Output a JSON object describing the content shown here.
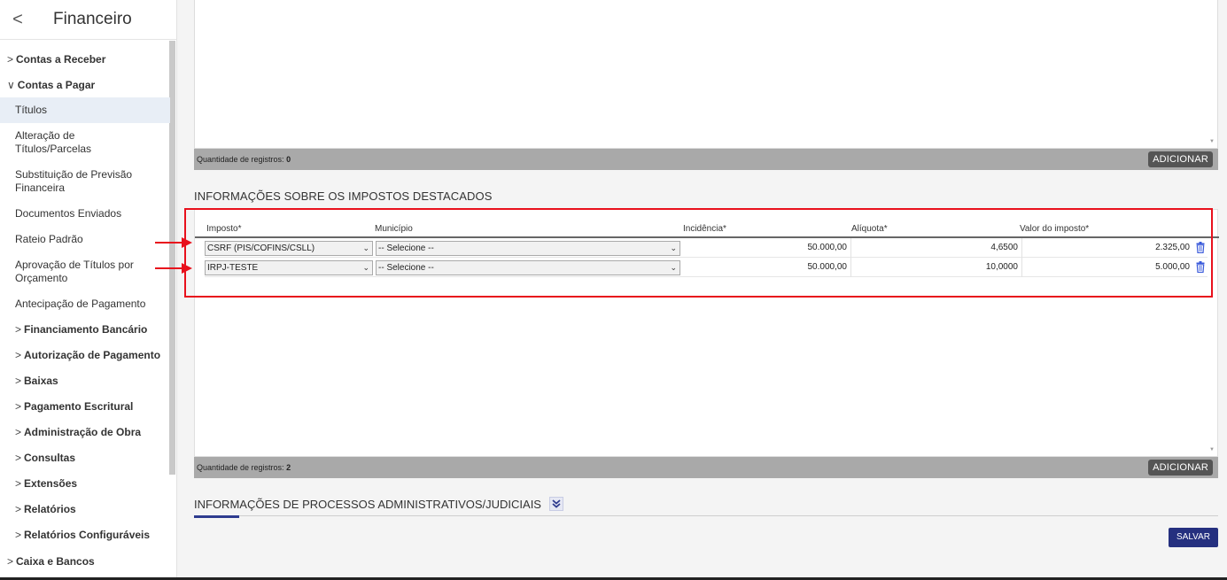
{
  "sidebar": {
    "back_icon": "chevron-left-icon",
    "title": "Financeiro",
    "items": [
      {
        "label": "Contas a Receber",
        "level": 1,
        "chevron": ">"
      },
      {
        "label": "Contas a Pagar",
        "level": 1,
        "chevron": "∨"
      },
      {
        "label": "Títulos",
        "level": 2,
        "active": true
      },
      {
        "label": "Alteração de Títulos/Parcelas",
        "level": 2
      },
      {
        "label": "Substituição de Previsão Financeira",
        "level": 2
      },
      {
        "label": "Documentos Enviados",
        "level": 2
      },
      {
        "label": "Rateio Padrão",
        "level": 2
      },
      {
        "label": "Aprovação de Títulos por Orçamento",
        "level": 2
      },
      {
        "label": "Antecipação de Pagamento",
        "level": 2
      },
      {
        "label": "Financiamento Bancário",
        "level": 2,
        "chevron": ">"
      },
      {
        "label": "Autorização de Pagamento",
        "level": 2,
        "chevron": ">"
      },
      {
        "label": "Baixas",
        "level": 2,
        "chevron": ">"
      },
      {
        "label": "Pagamento Escritural",
        "level": 2,
        "chevron": ">"
      },
      {
        "label": "Administração de Obra",
        "level": 2,
        "chevron": ">"
      },
      {
        "label": "Consultas",
        "level": 2,
        "chevron": ">"
      },
      {
        "label": "Extensões",
        "level": 2,
        "chevron": ">"
      },
      {
        "label": "Relatórios",
        "level": 2,
        "chevron": ">"
      },
      {
        "label": "Relatórios Configuráveis",
        "level": 2,
        "chevron": ">"
      },
      {
        "label": "Caixa e Bancos",
        "level": 1,
        "chevron": ">"
      }
    ]
  },
  "top_panel": {
    "records_label": "Quantidade de registros:",
    "records_count": "0",
    "add_label": "ADICIONAR"
  },
  "taxes": {
    "section_title": "INFORMAÇÕES SOBRE OS IMPOSTOS DESTACADOS",
    "headers": {
      "imposto": "Imposto*",
      "municipio": "Município",
      "incidencia": "Incidência*",
      "aliquota": "Alíquota*",
      "valor": "Valor do imposto*"
    },
    "rows": [
      {
        "imposto": "CSRF (PIS/COFINS/CSLL)",
        "municipio": "-- Selecione --",
        "incidencia": "50.000,00",
        "aliquota": "4,6500",
        "valor": "2.325,00"
      },
      {
        "imposto": "IRPJ-TESTE",
        "municipio": "-- Selecione --",
        "incidencia": "50.000,00",
        "aliquota": "10,0000",
        "valor": "5.000,00"
      }
    ],
    "records_label": "Quantidade de registros:",
    "records_count": "2",
    "add_label": "ADICIONAR"
  },
  "processes": {
    "section_title": "INFORMAÇÕES DE PROCESSOS ADMINISTRATIVOS/JUDICIAIS",
    "toggle_icon": "double-chevron-down-icon"
  },
  "save_label": "SALVAR",
  "colors": {
    "annotation_red": "#e8101c",
    "primary": "#25307f",
    "bar_gray": "#a9a9a9",
    "trash_blue": "#3b5bdb"
  }
}
